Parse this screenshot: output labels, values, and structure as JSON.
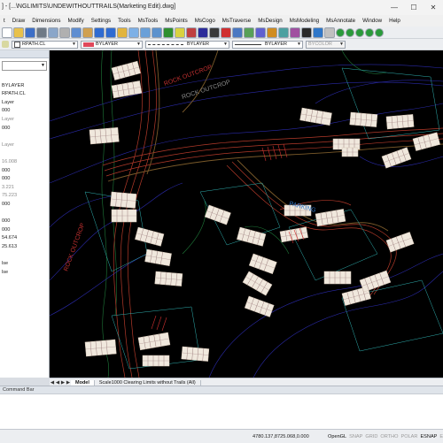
{
  "window": {
    "title": "] - [...\\NGLIMITS\\UNDEWITHOUTTRAILS(Marketing Edit).dwg]",
    "minimize": "—",
    "maximize": "☐",
    "close": "✕"
  },
  "menu": [
    "t",
    "Draw",
    "Dimensions",
    "Modify",
    "Settings",
    "Tools",
    "MsTools",
    "MsPoints",
    "MsCogo",
    "MsTraverse",
    "MsDesign",
    "MsModeling",
    "MsAnnotate",
    "Window",
    "Help"
  ],
  "toolbar1": {
    "icons": [
      {
        "name": "new-icon",
        "color": "#ffffff"
      },
      {
        "name": "open-icon",
        "color": "#e8c14b"
      },
      {
        "name": "save-icon",
        "color": "#3d6fc7"
      },
      {
        "name": "print-icon",
        "color": "#6f7a86"
      },
      {
        "name": "preview-icon",
        "color": "#8aa6c9"
      },
      {
        "name": "cut-icon",
        "color": "#b0b0b0"
      },
      {
        "name": "copy-icon",
        "color": "#5f8ed1"
      },
      {
        "name": "paste-icon",
        "color": "#d0a050"
      },
      {
        "name": "undo-icon",
        "color": "#2f6bd1"
      },
      {
        "name": "redo-icon",
        "color": "#2f6bd1"
      },
      {
        "name": "pan-icon",
        "color": "#e2b43c"
      },
      {
        "name": "zoom-icon",
        "color": "#7db0e6"
      },
      {
        "name": "zoom-window-icon",
        "color": "#6aa0d8"
      },
      {
        "name": "zoom-prev-icon",
        "color": "#5c92cd"
      },
      {
        "name": "properties-icon",
        "color": "#2f8f2f"
      },
      {
        "name": "layer-icon",
        "color": "#d9d240"
      },
      {
        "name": "match-icon",
        "color": "#c04040"
      },
      {
        "name": "distance-icon",
        "color": "#2c2c9a"
      },
      {
        "name": "area-icon",
        "color": "#3a3a3a"
      },
      {
        "name": "check-icon",
        "color": "#d03030"
      },
      {
        "name": "block-icon",
        "color": "#4a78c2"
      },
      {
        "name": "insert-icon",
        "color": "#58a058"
      },
      {
        "name": "attrib-icon",
        "color": "#6060d0"
      },
      {
        "name": "xref-icon",
        "color": "#d08c20"
      },
      {
        "name": "image-icon",
        "color": "#4ca0a0"
      },
      {
        "name": "hatch-icon",
        "color": "#a050a0"
      },
      {
        "name": "text-icon",
        "color": "#2a2a2a"
      },
      {
        "name": "dim-icon",
        "color": "#2f77c9"
      },
      {
        "name": "render-icon",
        "color": "#c0c0c0"
      },
      {
        "name": "green-dot-1-icon",
        "color": "#2a9a3a"
      },
      {
        "name": "green-dot-2-icon",
        "color": "#2a9a3a"
      },
      {
        "name": "green-dot-3-icon",
        "color": "#2a9a3a"
      },
      {
        "name": "green-dot-4-icon",
        "color": "#2a9a3a"
      },
      {
        "name": "green-dot-5-icon",
        "color": "#2a9a3a"
      }
    ]
  },
  "toolbar2": {
    "layer_value": "RPATH.CL",
    "color_value": "BYLAYER",
    "linetype_value": "BYLAYER",
    "lineweight_value": "BYLAYER",
    "plotstyle_value": "BYCOLOR"
  },
  "properties": {
    "header_value": "BYLAYER",
    "rows": [
      {
        "text": "",
        "gray": false
      },
      {
        "text": "BYLAYER",
        "gray": false
      },
      {
        "text": "RPATH.CL",
        "gray": false
      },
      {
        "text": "Layer",
        "gray": false
      },
      {
        "text": "000",
        "gray": false
      },
      {
        "text": "Layer",
        "gray": true
      },
      {
        "text": "000",
        "gray": false
      },
      {
        "text": "",
        "gray": false
      },
      {
        "text": "Layer",
        "gray": true
      },
      {
        "text": "",
        "gray": false
      },
      {
        "text": "16.008",
        "gray": true
      },
      {
        "text": "000",
        "gray": false
      },
      {
        "text": "000",
        "gray": false
      },
      {
        "text": "3.221",
        "gray": true
      },
      {
        "text": "75.223",
        "gray": true
      },
      {
        "text": "000",
        "gray": false
      },
      {
        "text": "",
        "gray": false
      },
      {
        "text": "000",
        "gray": false
      },
      {
        "text": "000",
        "gray": false
      },
      {
        "text": "54.674",
        "gray": false
      },
      {
        "text": "25.613",
        "gray": false
      },
      {
        "text": "",
        "gray": false
      },
      {
        "text": "lse",
        "gray": false
      },
      {
        "text": "lse",
        "gray": false
      }
    ]
  },
  "canvas": {
    "labels": [
      "ROCK OUTCROP",
      "ROCK OUTCROP",
      "ROCK OUTCROP",
      "PARKING"
    ]
  },
  "tabs": {
    "items": [
      "Model",
      "Scale1000 Clearing Limits without Trails (All)"
    ],
    "active": "Model"
  },
  "command": {
    "bar_label": "Command Bar"
  },
  "status": {
    "coords": "4780.137,8725.068,0.000",
    "toggles": [
      {
        "label": "OpenGL",
        "on": true
      },
      {
        "label": "SNAP",
        "on": false
      },
      {
        "label": "GRID",
        "on": false
      },
      {
        "label": "ORTHO",
        "on": false
      },
      {
        "label": "POLAR",
        "on": false
      },
      {
        "label": "ESNAP",
        "on": true
      },
      {
        "label": "ETRACK",
        "on": false
      }
    ]
  }
}
